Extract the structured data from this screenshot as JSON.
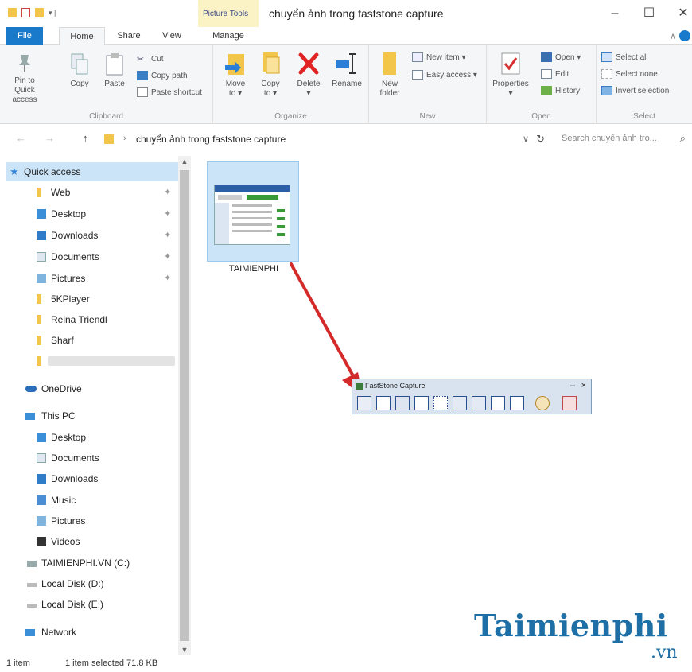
{
  "window": {
    "contextual_tab_group": "Picture Tools",
    "title": "chuyển ảnh trong faststone capture",
    "minimize": "–",
    "maximize": "☐",
    "close": "✕"
  },
  "tabs": {
    "file": "File",
    "home": "Home",
    "share": "Share",
    "view": "View",
    "manage": "Manage"
  },
  "ribbon": {
    "clipboard": {
      "label": "Clipboard",
      "pin_line1": "Pin to Quick",
      "pin_line2": "access",
      "copy": "Copy",
      "paste": "Paste",
      "cut": "Cut",
      "copy_path": "Copy path",
      "paste_shortcut": "Paste shortcut"
    },
    "organize": {
      "label": "Organize",
      "move_to": "Move",
      "move_to_2": "to ▾",
      "copy_to": "Copy",
      "copy_to_2": "to ▾",
      "delete": "Delete",
      "delete_2": "▾",
      "rename": "Rename"
    },
    "new": {
      "label": "New",
      "new_folder": "New",
      "new_folder_2": "folder",
      "new_item": "New item ▾",
      "easy_access": "Easy access ▾"
    },
    "open": {
      "label": "Open",
      "properties": "Properties",
      "properties_2": "▾",
      "open": "Open ▾",
      "edit": "Edit",
      "history": "History"
    },
    "select": {
      "label": "Select",
      "select_all": "Select all",
      "select_none": "Select none",
      "invert_selection": "Invert selection"
    }
  },
  "address": {
    "back": "←",
    "forward": "→",
    "up": "↑",
    "separator": "›",
    "path": "chuyển ảnh trong faststone capture",
    "dropdown": "∨",
    "refresh": "↻",
    "search_placeholder": "Search chuyển ảnh tro...",
    "search_icon": "⌕"
  },
  "nav": {
    "scroll_up": "▲",
    "scroll_down": "▼",
    "pin_glyph": "✦",
    "items": [
      {
        "label": "Quick access"
      },
      {
        "label": "Web"
      },
      {
        "label": "Desktop"
      },
      {
        "label": "Downloads"
      },
      {
        "label": "Documents"
      },
      {
        "label": "Pictures"
      },
      {
        "label": "5KPlayer"
      },
      {
        "label": "Reina Triendl"
      },
      {
        "label": "Sharf"
      },
      {
        "label": ""
      },
      {
        "label": "OneDrive"
      },
      {
        "label": "This PC"
      },
      {
        "label": "Desktop"
      },
      {
        "label": "Documents"
      },
      {
        "label": "Downloads"
      },
      {
        "label": "Music"
      },
      {
        "label": "Pictures"
      },
      {
        "label": "Videos"
      },
      {
        "label": "TAIMIENPHI.VN (C:)"
      },
      {
        "label": "Local Disk (D:)"
      },
      {
        "label": "Local Disk (E:)"
      },
      {
        "label": "Network"
      }
    ]
  },
  "content": {
    "file_name": "TAIMIENPHI"
  },
  "faststone": {
    "title": "FastStone Capture",
    "minimize": "–",
    "close": "×"
  },
  "status": {
    "count": "1 item",
    "selected": "1 item selected  71.8 KB"
  },
  "watermark": {
    "brand": "Taimienphi",
    "domain": ".vn"
  },
  "colors": {
    "accent": "#1979ca",
    "selection": "#cce4f7",
    "arrow": "#d42a2a",
    "folder": "#f2c54b"
  }
}
